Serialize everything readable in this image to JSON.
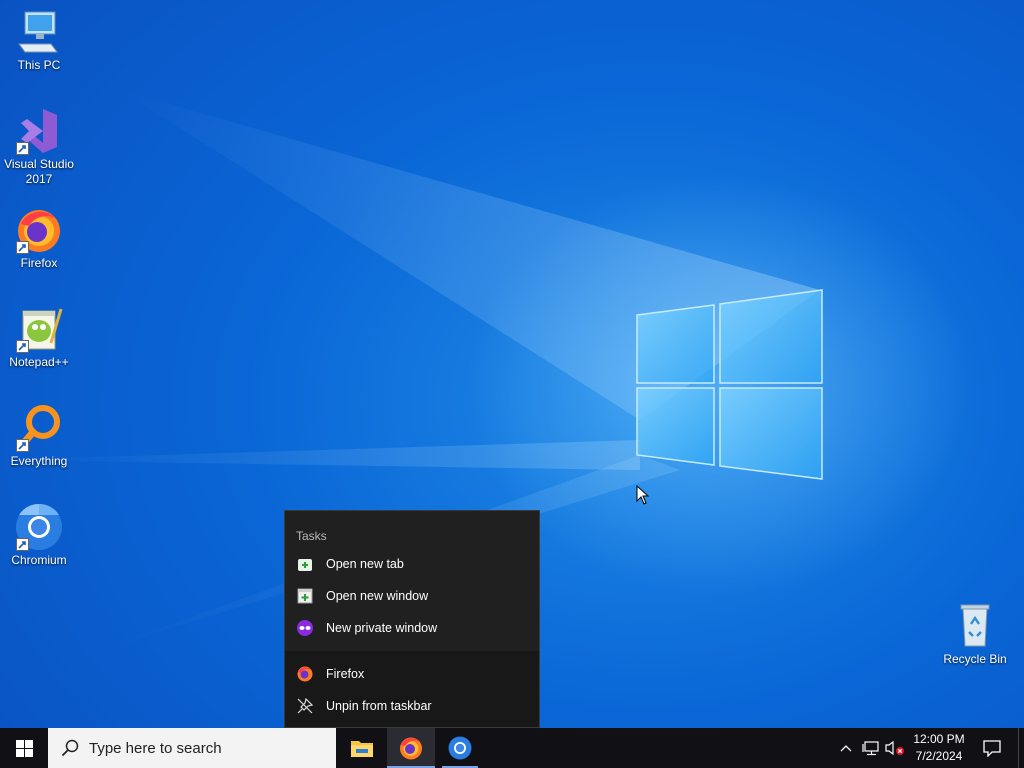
{
  "desktop": {
    "icons": [
      {
        "label": "This PC",
        "icon": "computer-icon"
      },
      {
        "label": "Visual Studio 2017",
        "icon": "visual-studio-icon"
      },
      {
        "label": "Firefox",
        "icon": "firefox-icon"
      },
      {
        "label": "Notepad++",
        "icon": "notepadpp-icon"
      },
      {
        "label": "Everything",
        "icon": "everything-search-icon"
      },
      {
        "label": "Chromium",
        "icon": "chromium-icon"
      },
      {
        "label": "Recycle Bin",
        "icon": "recycle-bin-icon"
      }
    ]
  },
  "jumplist": {
    "section_title": "Tasks",
    "tasks": [
      {
        "label": "Open new tab",
        "icon": "new-tab-icon"
      },
      {
        "label": "Open new window",
        "icon": "new-window-icon"
      },
      {
        "label": "New private window",
        "icon": "private-mask-icon"
      }
    ],
    "pinned": [
      {
        "label": "Firefox",
        "icon": "firefox-icon"
      },
      {
        "label": "Unpin from taskbar",
        "icon": "unpin-icon"
      }
    ]
  },
  "taskbar": {
    "search_placeholder": "Type here to search",
    "apps": [
      {
        "name": "File Explorer",
        "icon": "folder-icon"
      },
      {
        "name": "Firefox",
        "icon": "firefox-icon",
        "active": true
      },
      {
        "name": "Chromium",
        "icon": "chromium-icon"
      }
    ],
    "clock": {
      "time": "12:00 PM",
      "date": "7/2/2024"
    }
  },
  "colors": {
    "desktop_blue": "#0a66d6",
    "taskbar_bg": "#101015",
    "jumplist_bg": "#202020",
    "active_underline": "#7aa6e8"
  }
}
